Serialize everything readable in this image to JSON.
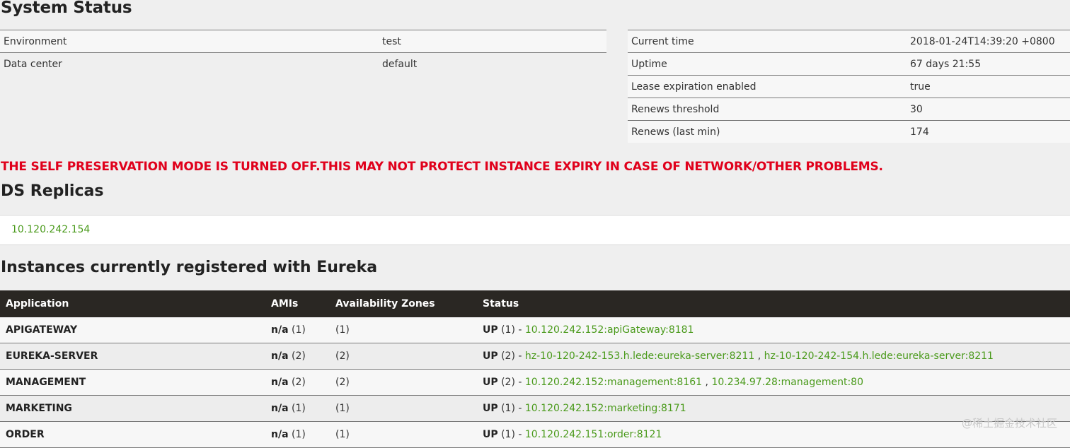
{
  "headings": {
    "system_status": "System Status",
    "ds_replicas": "DS Replicas",
    "instances": "Instances currently registered with Eureka"
  },
  "environment": {
    "rows": [
      {
        "key": "Environment",
        "value": "test"
      },
      {
        "key": "Data center",
        "value": "default"
      }
    ]
  },
  "status_info": {
    "rows": [
      {
        "key": "Current time",
        "value": "2018-01-24T14:39:20 +0800"
      },
      {
        "key": "Uptime",
        "value": "67 days 21:55"
      },
      {
        "key": "Lease expiration enabled",
        "value": "true"
      },
      {
        "key": "Renews threshold",
        "value": "30"
      },
      {
        "key": "Renews (last min)",
        "value": "174"
      }
    ]
  },
  "warning": "THE SELF PRESERVATION MODE IS TURNED OFF.THIS MAY NOT PROTECT INSTANCE EXPIRY IN CASE OF NETWORK/OTHER PROBLEMS.",
  "replicas": [
    "10.120.242.154"
  ],
  "instances": {
    "columns": [
      "Application",
      "AMIs",
      "Availability Zones",
      "Status"
    ],
    "rows": [
      {
        "app": "APIGATEWAY",
        "ami": "n/a",
        "ami_count": "(1)",
        "zones": "(1)",
        "status": "UP",
        "status_count": "(1) - ",
        "links": [
          "10.120.242.152:apiGateway:8181"
        ]
      },
      {
        "app": "EUREKA-SERVER",
        "ami": "n/a",
        "ami_count": "(2)",
        "zones": "(2)",
        "status": "UP",
        "status_count": "(2) - ",
        "links": [
          "hz-10-120-242-153.h.lede:eureka-server:8211",
          "hz-10-120-242-154.h.lede:eureka-server:8211"
        ]
      },
      {
        "app": "MANAGEMENT",
        "ami": "n/a",
        "ami_count": "(2)",
        "zones": "(2)",
        "status": "UP",
        "status_count": "(2) - ",
        "links": [
          "10.120.242.152:management:8161",
          "10.234.97.28:management:80"
        ]
      },
      {
        "app": "MARKETING",
        "ami": "n/a",
        "ami_count": "(1)",
        "zones": "(1)",
        "status": "UP",
        "status_count": "(1) - ",
        "links": [
          "10.120.242.152:marketing:8171"
        ]
      },
      {
        "app": "ORDER",
        "ami": "n/a",
        "ami_count": "(1)",
        "zones": "(1)",
        "status": "UP",
        "status_count": "(1) - ",
        "links": [
          "10.120.242.151:order:8121"
        ]
      }
    ]
  },
  "link_separator": " , ",
  "watermark": "@稀土掘金技术社区",
  "colors": {
    "warning": "#e0001b",
    "link": "#4a9a1b",
    "table_header_bg": "#2a2723"
  }
}
